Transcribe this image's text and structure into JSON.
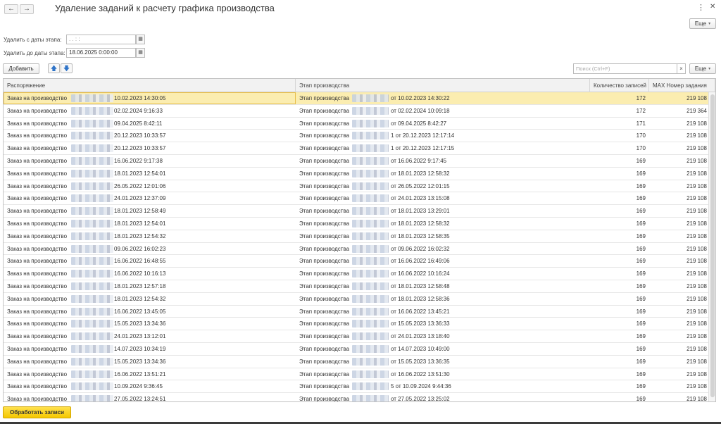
{
  "window": {
    "title": "Удаление заданий к расчету графика производства",
    "back_label": "←",
    "forward_label": "→",
    "menu_label": "⋮",
    "close_label": "✕"
  },
  "colors": {
    "selected_row": "#fbedb0",
    "primary_button": "#f5c800",
    "arrow": "#2f74c8"
  },
  "header_more": {
    "label": "Еще",
    "caret": "▾"
  },
  "filters": {
    "from_label": "Удалить с даты этапа:",
    "from_value": " .  .      :  :",
    "to_label": "Удалить до даты этапа:",
    "to_value": "18.06.2025  0:00:00",
    "calendar_icon": "▦"
  },
  "toolbar": {
    "add_label": "Добавить",
    "up_icon": "🡅",
    "down_icon": "🡇",
    "search_placeholder": "Поиск (Ctrl+F)",
    "search_clear": "×",
    "more_label": "Еще",
    "more_caret": "▾"
  },
  "table": {
    "columns": [
      "Распоряжение",
      "Этап производства",
      "Количество записей",
      "MAX Номер задания"
    ],
    "rows": [
      {
        "order_prefix": "Заказ на производство",
        "order_date": "10.02.2023 14:30:05",
        "stage_prefix": "Этап производства",
        "stage_suffix": "от 10.02.2023 14:30:22",
        "count": "172",
        "max": "219 108"
      },
      {
        "order_prefix": "Заказ на производство",
        "order_date": "02.02.2024 9:16:33",
        "stage_prefix": "Этап производства",
        "stage_suffix": "от 02.02.2024 10:09:18",
        "count": "172",
        "max": "219 364"
      },
      {
        "order_prefix": "Заказ на производство",
        "order_date": "09.04.2025 8:42:11",
        "stage_prefix": "Этап производства",
        "stage_suffix": "от 09.04.2025 8:42:27",
        "count": "171",
        "max": "219 108"
      },
      {
        "order_prefix": "Заказ на производство",
        "order_date": "20.12.2023 10:33:57",
        "stage_prefix": "Этап производства",
        "stage_suffix": "1 от 20.12.2023 12:17:14",
        "count": "170",
        "max": "219 108"
      },
      {
        "order_prefix": "Заказ на производство",
        "order_date": "20.12.2023 10:33:57",
        "stage_prefix": "Этап производства",
        "stage_suffix": "1 от 20.12.2023 12:17:15",
        "count": "170",
        "max": "219 108"
      },
      {
        "order_prefix": "Заказ на производство",
        "order_date": "16.06.2022 9:17:38",
        "stage_prefix": "Этап производства",
        "stage_suffix": "от 16.06.2022 9:17:45",
        "count": "169",
        "max": "219 108"
      },
      {
        "order_prefix": "Заказ на производство",
        "order_date": "18.01.2023 12:54:01",
        "stage_prefix": "Этап производства",
        "stage_suffix": "от 18.01.2023 12:58:32",
        "count": "169",
        "max": "219 108"
      },
      {
        "order_prefix": "Заказ на производство",
        "order_date": "26.05.2022 12:01:06",
        "stage_prefix": "Этап производства",
        "stage_suffix": "от 26.05.2022 12:01:15",
        "count": "169",
        "max": "219 108"
      },
      {
        "order_prefix": "Заказ на производство",
        "order_date": "24.01.2023 12:37:09",
        "stage_prefix": "Этап производства",
        "stage_suffix": "от 24.01.2023 13:15:08",
        "count": "169",
        "max": "219 108"
      },
      {
        "order_prefix": "Заказ на производство",
        "order_date": "18.01.2023 12:58:49",
        "stage_prefix": "Этап производства",
        "stage_suffix": "от 18.01.2023 13:29:01",
        "count": "169",
        "max": "219 108"
      },
      {
        "order_prefix": "Заказ на производство",
        "order_date": "18.01.2023 12:54:01",
        "stage_prefix": "Этап производства",
        "stage_suffix": "от 18.01.2023 12:58:32",
        "count": "169",
        "max": "219 108"
      },
      {
        "order_prefix": "Заказ на производство",
        "order_date": "18.01.2023 12:54:32",
        "stage_prefix": "Этап производства",
        "stage_suffix": "от 18.01.2023 12:58:35",
        "count": "169",
        "max": "219 108"
      },
      {
        "order_prefix": "Заказ на производство",
        "order_date": "09.06.2022 16:02:23",
        "stage_prefix": "Этап производства",
        "stage_suffix": "от 09.06.2022 16:02:32",
        "count": "169",
        "max": "219 108"
      },
      {
        "order_prefix": "Заказ на производство",
        "order_date": "16.06.2022 16:48:55",
        "stage_prefix": "Этап производства",
        "stage_suffix": "от 16.06.2022 16:49:06",
        "count": "169",
        "max": "219 108"
      },
      {
        "order_prefix": "Заказ на производство",
        "order_date": "16.06.2022 10:16:13",
        "stage_prefix": "Этап производства",
        "stage_suffix": "от 16.06.2022 10:16:24",
        "count": "169",
        "max": "219 108"
      },
      {
        "order_prefix": "Заказ на производство",
        "order_date": "18.01.2023 12:57:18",
        "stage_prefix": "Этап производства",
        "stage_suffix": "от 18.01.2023 12:58:48",
        "count": "169",
        "max": "219 108"
      },
      {
        "order_prefix": "Заказ на производство",
        "order_date": "18.01.2023 12:54:32",
        "stage_prefix": "Этап производства",
        "stage_suffix": "от 18.01.2023 12:58:36",
        "count": "169",
        "max": "219 108"
      },
      {
        "order_prefix": "Заказ на производство",
        "order_date": "16.06.2022 13:45:05",
        "stage_prefix": "Этап производства",
        "stage_suffix": "от 16.06.2022 13:45:21",
        "count": "169",
        "max": "219 108"
      },
      {
        "order_prefix": "Заказ на производство",
        "order_date": "15.05.2023 13:34:36",
        "stage_prefix": "Этап производства",
        "stage_suffix": "от 15.05.2023 13:36:33",
        "count": "169",
        "max": "219 108"
      },
      {
        "order_prefix": "Заказ на производство",
        "order_date": "24.01.2023 13:12:01",
        "stage_prefix": "Этап производства",
        "stage_suffix": "от 24.01.2023 13:18:40",
        "count": "169",
        "max": "219 108"
      },
      {
        "order_prefix": "Заказ на производство",
        "order_date": "14.07.2023 10:34:19",
        "stage_prefix": "Этап производства",
        "stage_suffix": "от 14.07.2023 10:49:00",
        "count": "169",
        "max": "219 108"
      },
      {
        "order_prefix": "Заказ на производство",
        "order_date": "15.05.2023 13:34:36",
        "stage_prefix": "Этап производства",
        "stage_suffix": "от 15.05.2023 13:36:35",
        "count": "169",
        "max": "219 108"
      },
      {
        "order_prefix": "Заказ на производство",
        "order_date": "16.06.2022 13:51:21",
        "stage_prefix": "Этап производства",
        "stage_suffix": "от 16.06.2022 13:51:30",
        "count": "169",
        "max": "219 108"
      },
      {
        "order_prefix": "Заказ на производство",
        "order_date": "10.09.2024 9:36:45",
        "stage_prefix": "Этап производства",
        "stage_suffix": "5 от 10.09.2024 9:44:36",
        "count": "169",
        "max": "219 108"
      },
      {
        "order_prefix": "Заказ на производство",
        "order_date": "27.05.2022 13:24:51",
        "stage_prefix": "Этап производства",
        "stage_suffix": "от 27.05.2022 13:25:02",
        "count": "169",
        "max": "219 108"
      }
    ]
  },
  "footer": {
    "process_label": "Обработать записи"
  }
}
